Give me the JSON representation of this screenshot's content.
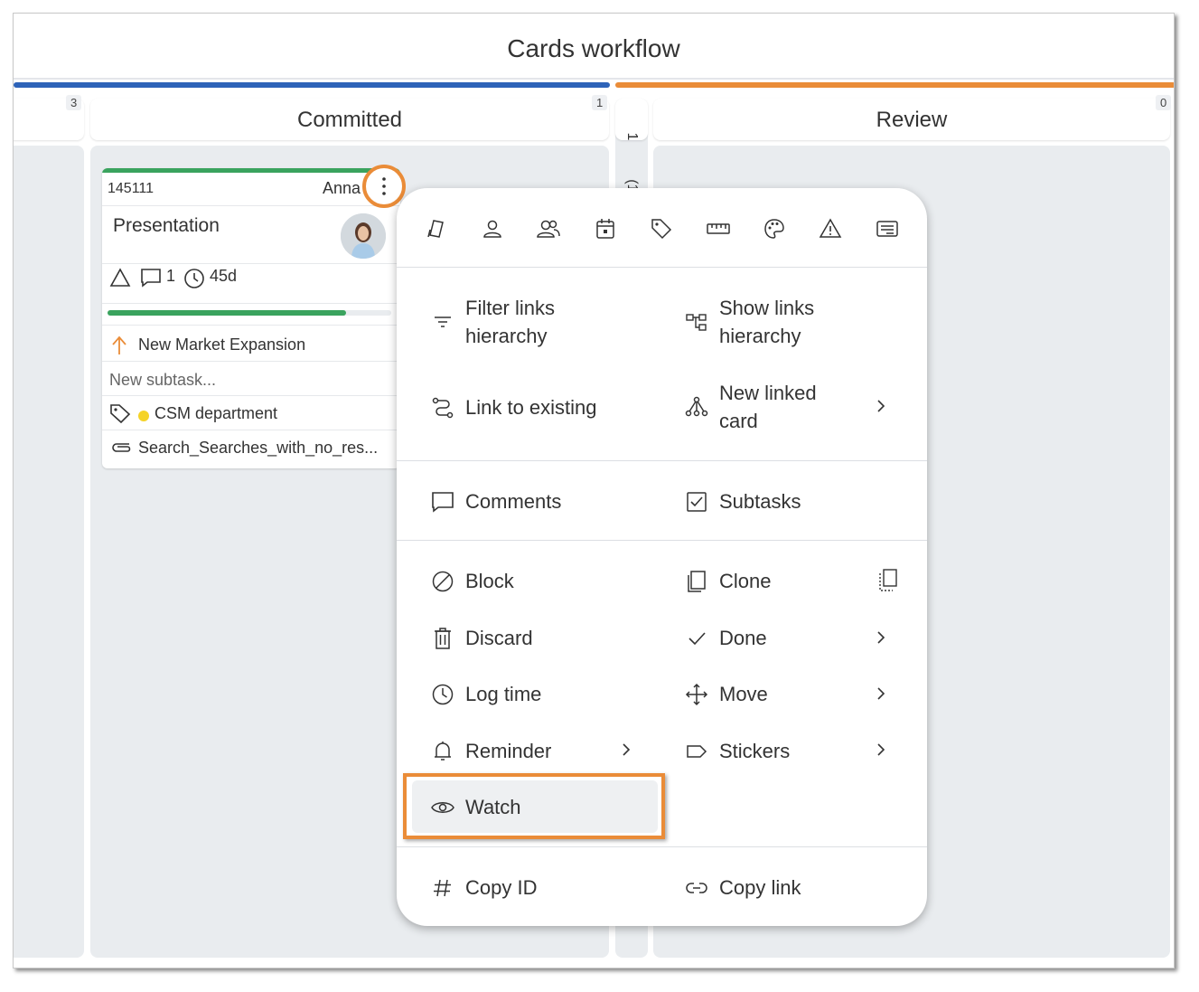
{
  "board": {
    "title": "Cards workflow",
    "colors": {
      "lane_left": "#2e63b8",
      "lane_right": "#ea8c38",
      "highlight": "#ea8c38",
      "progress": "#3aa35e"
    }
  },
  "columns": {
    "left_wip": "3",
    "committed": {
      "title": "Committed",
      "wip": "1"
    },
    "collapsed": {
      "title": "1",
      "count": "(1)"
    },
    "review": {
      "title": "Review",
      "wip": "0"
    }
  },
  "card": {
    "id": "145111",
    "owner": "Anna",
    "title": "Presentation",
    "comments_count": "1",
    "age": "45d",
    "progress": 0.84,
    "parent": "New Market Expansion",
    "subtask_placeholder": "New subtask...",
    "tag": "CSM department",
    "tag_color": "#f5d327",
    "attachment": "Search_Searches_with_no_res..."
  },
  "menu": {
    "icon_bar": [
      "card-type-icon",
      "person-icon",
      "people-icon",
      "calendar-icon",
      "tag-icon",
      "ruler-icon",
      "palette-icon",
      "warning-icon",
      "template-icon"
    ],
    "links": {
      "filter": "Filter links hierarchy",
      "show": "Show links hierarchy",
      "existing": "Link to existing",
      "new_linked": "New linked card"
    },
    "comments": "Comments",
    "subtasks": "Subtasks",
    "block": "Block",
    "clone": "Clone",
    "discard": "Discard",
    "done": "Done",
    "log_time": "Log time",
    "move": "Move",
    "reminder": "Reminder",
    "stickers": "Stickers",
    "watch": "Watch",
    "copy_id": "Copy ID",
    "copy_link": "Copy link"
  }
}
